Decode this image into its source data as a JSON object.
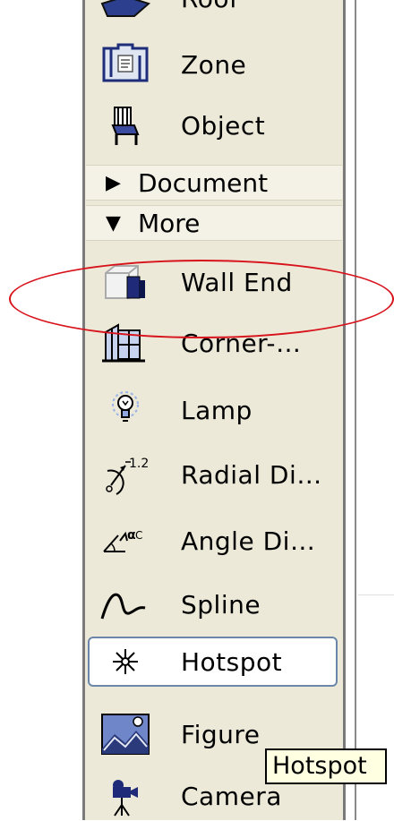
{
  "toolbox": {
    "items": [
      {
        "label": "Roof",
        "icon": "roof-icon"
      },
      {
        "label": "Zone",
        "icon": "zone-icon"
      },
      {
        "label": "Object",
        "icon": "object-icon"
      },
      {
        "label": "Wall End",
        "icon": "wall-end-icon"
      },
      {
        "label": "Corner-…",
        "icon": "corner-window-icon"
      },
      {
        "label": "Lamp",
        "icon": "lamp-icon"
      },
      {
        "label": "Radial Di…",
        "icon": "radial-dimension-icon"
      },
      {
        "label": "Angle Di…",
        "icon": "angle-dimension-icon"
      },
      {
        "label": "Spline",
        "icon": "spline-icon"
      },
      {
        "label": "Hotspot",
        "icon": "hotspot-icon"
      },
      {
        "label": "Figure",
        "icon": "figure-icon"
      },
      {
        "label": "Camera",
        "icon": "camera-icon"
      }
    ],
    "sections": [
      {
        "label": "Document",
        "state": "collapsed"
      },
      {
        "label": "More",
        "state": "expanded"
      }
    ],
    "tooltip": "Hotspot",
    "highlight_color": "#d8121b"
  }
}
